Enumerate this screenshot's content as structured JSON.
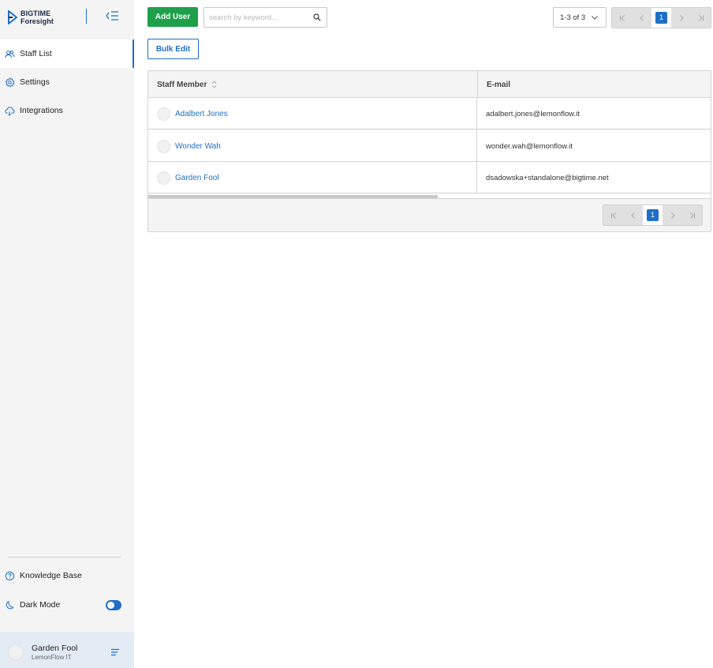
{
  "app": {
    "brand_line1": "BIGTIME",
    "brand_line2": "Foresight"
  },
  "sidebar": {
    "items": [
      {
        "label": "Staff List",
        "icon": "users-icon",
        "active": true
      },
      {
        "label": "Settings",
        "icon": "gear-icon",
        "active": false
      },
      {
        "label": "Integrations",
        "icon": "cloud-icon",
        "active": false
      }
    ],
    "bottom": {
      "knowledge_base": "Knowledge Base",
      "dark_mode": "Dark Mode",
      "dark_mode_on": true
    },
    "user": {
      "name": "Garden Fool",
      "org": "LemonFlow IT"
    }
  },
  "toolbar": {
    "add_user_label": "Add User",
    "search_placeholder": "search by keyword...",
    "search_value": "",
    "range_label": "1-3 of 3",
    "bulk_edit_label": "Bulk Edit",
    "current_page": "1"
  },
  "table": {
    "columns": [
      "Staff Member",
      "E-mail"
    ],
    "rows": [
      {
        "name": "Adalbert Jones",
        "email": "adalbert.jones@lemonflow.it"
      },
      {
        "name": "Wonder Wah",
        "email": "wonder.wah@lemonflow.it"
      },
      {
        "name": "Garden Fool",
        "email": "dsadowska+standalone@bigtime.net"
      }
    ],
    "current_page": "1"
  },
  "colors": {
    "accent": "#1f6fc6",
    "add_button": "#1ea04a",
    "sidebar_bg": "#f4f4f4",
    "user_card_bg": "#e3ebf5"
  }
}
